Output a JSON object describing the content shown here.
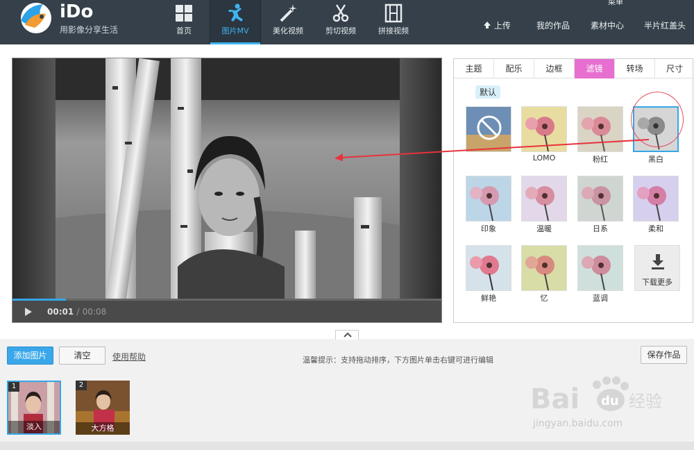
{
  "app": {
    "brand": "iDo",
    "slogan": "用影像分享生活"
  },
  "nav": [
    {
      "label": "首页",
      "icon": "grid-icon"
    },
    {
      "label": "图片MV",
      "icon": "dancer-icon",
      "active": true
    },
    {
      "label": "美化视频",
      "icon": "magic-wand-icon"
    },
    {
      "label": "剪切视频",
      "icon": "scissors-icon"
    },
    {
      "label": "拼接视频",
      "icon": "film-icon"
    }
  ],
  "right_links": {
    "upload": "上传",
    "works": "我的作品",
    "materials": "素材中心",
    "banner": "半片红盖头",
    "menu_cut": "菜单"
  },
  "player": {
    "current": "00:01",
    "sep": "/",
    "total": "00:08",
    "progress_fraction": 0.125
  },
  "tabs": [
    {
      "label": "主题"
    },
    {
      "label": "配乐"
    },
    {
      "label": "边框"
    },
    {
      "label": "滤镜",
      "active": true
    },
    {
      "label": "转场"
    },
    {
      "label": "尺寸"
    }
  ],
  "filter_category": "默认",
  "filters": [
    {
      "label": "",
      "kind": "none"
    },
    {
      "label": "LOMO",
      "kind": "lomo"
    },
    {
      "label": "粉红",
      "kind": "pink"
    },
    {
      "label": "黑白",
      "kind": "bw",
      "selected": true
    },
    {
      "label": "印象",
      "kind": "impression"
    },
    {
      "label": "温暖",
      "kind": "warm"
    },
    {
      "label": "日系",
      "kind": "japanese"
    },
    {
      "label": "柔和",
      "kind": "soft"
    },
    {
      "label": "鲜艳",
      "kind": "vivid"
    },
    {
      "label": "忆",
      "kind": "memory"
    },
    {
      "label": "蓝调",
      "kind": "blue"
    }
  ],
  "download_more": "下载更多",
  "toolbar": {
    "add": "添加图片",
    "clear": "清空",
    "help": "使用帮助",
    "tip": "温馨提示：支持拖动排序，下方图片单击右键可进行编辑",
    "save": "保存作品"
  },
  "strip": [
    {
      "num": "1",
      "caption": "淡入",
      "selected": true
    },
    {
      "num": "2",
      "caption": "大方格"
    }
  ],
  "watermark": {
    "text": "jingyan.baidu.com"
  },
  "colors": {
    "header": "#35404a",
    "accent": "#3aa7ea",
    "active_tab": "#e76fd0",
    "annotation": "#e64a5a"
  }
}
